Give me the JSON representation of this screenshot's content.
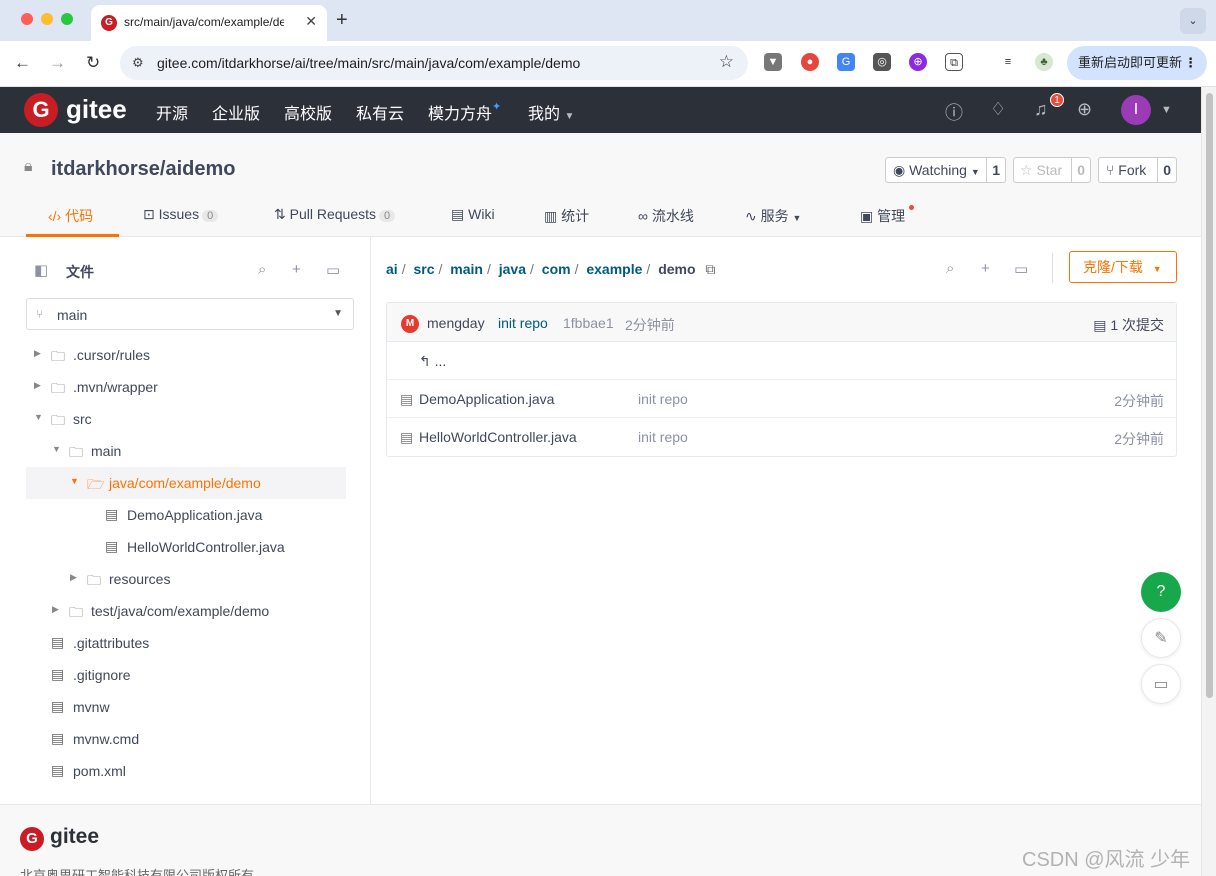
{
  "browser": {
    "tab_title": "src/main/java/com/example/demo",
    "url": "gitee.com/itdarkhorse/ai/tree/main/src/main/java/com/example/demo",
    "update_button": "重新启动即可更新"
  },
  "gitee_nav": {
    "brand": "gitee",
    "items": [
      "开源",
      "企业版",
      "高校版",
      "私有云",
      "模力方舟",
      "我的"
    ],
    "notification_count": "1",
    "avatar_letter": "I"
  },
  "repo": {
    "name": "itdarkhorse/aidemo",
    "watching_label": "Watching",
    "watching_count": "1",
    "star_label": "Star",
    "star_count": "0",
    "fork_label": "Fork",
    "fork_count": "0",
    "tabs": [
      {
        "label": "代码"
      },
      {
        "label": "Issues",
        "count": "0"
      },
      {
        "label": "Pull Requests",
        "count": "0"
      },
      {
        "label": "Wiki"
      },
      {
        "label": "统计"
      },
      {
        "label": "流水线"
      },
      {
        "label": "服务"
      },
      {
        "label": "管理"
      }
    ]
  },
  "sidebar": {
    "title": "文件",
    "branch": "main",
    "tree": [
      {
        "label": ".cursor/rules",
        "type": "folder"
      },
      {
        "label": ".mvn/wrapper",
        "type": "folder"
      },
      {
        "label": "src",
        "type": "folder"
      },
      {
        "label": "main",
        "type": "folder"
      },
      {
        "label": "java/com/example/demo",
        "type": "folder"
      },
      {
        "label": "DemoApplication.java",
        "type": "file"
      },
      {
        "label": "HelloWorldController.java",
        "type": "file"
      },
      {
        "label": "resources",
        "type": "folder"
      },
      {
        "label": "test/java/com/example/demo",
        "type": "folder"
      },
      {
        "label": ".gitattributes",
        "type": "file"
      },
      {
        "label": ".gitignore",
        "type": "file"
      },
      {
        "label": "mvnw",
        "type": "file"
      },
      {
        "label": "mvnw.cmd",
        "type": "file"
      },
      {
        "label": "pom.xml",
        "type": "file"
      }
    ]
  },
  "main": {
    "breadcrumb": [
      "ai",
      "src",
      "main",
      "java",
      "com",
      "example",
      "demo"
    ],
    "clone_button": "克隆/下载",
    "commit": {
      "author": "mengday",
      "avatar_letter": "M",
      "message": "init repo",
      "hash": "1fbbae1",
      "time": "2分钟前",
      "count_label": "1 次提交"
    },
    "parent_link": "...",
    "files": [
      {
        "name": "DemoApplication.java",
        "message": "init repo",
        "time": "2分钟前"
      },
      {
        "name": "HelloWorldController.java",
        "message": "init repo",
        "time": "2分钟前"
      }
    ]
  },
  "footer": {
    "brand": "gitee",
    "copyright": "北京奥思研工智能科技有限公司版权所有"
  },
  "watermark": "CSDN @风流 少年"
}
